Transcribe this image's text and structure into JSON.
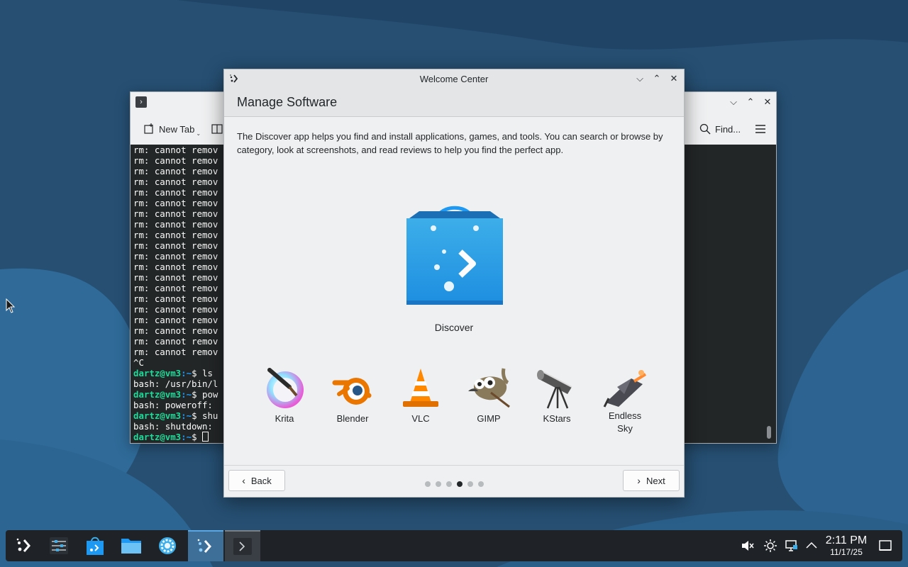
{
  "terminal_window": {
    "toolbar": {
      "new_tab_label": "New Tab",
      "find_label": "Find..."
    },
    "lines": [
      {
        "text": "rm: cannot remov"
      },
      {
        "text": "rm: cannot remov"
      },
      {
        "text": "rm: cannot remov"
      },
      {
        "text": "rm: cannot remov"
      },
      {
        "text": "rm: cannot remov"
      },
      {
        "text": "rm: cannot remov"
      },
      {
        "text": "rm: cannot remov"
      },
      {
        "text": "rm: cannot remov"
      },
      {
        "text": "rm: cannot remov"
      },
      {
        "text": "rm: cannot remov"
      },
      {
        "text": "rm: cannot remov"
      },
      {
        "text": "rm: cannot remov"
      },
      {
        "text": "rm: cannot remov"
      },
      {
        "text": "rm: cannot remov"
      },
      {
        "text": "rm: cannot remov"
      },
      {
        "text": "rm: cannot remov"
      },
      {
        "text": "rm: cannot remov"
      },
      {
        "text": "rm: cannot remov"
      },
      {
        "text": "rm: cannot remov"
      },
      {
        "text": "rm: cannot remov"
      },
      {
        "text": "^C"
      },
      {
        "user": "dartz@vm3",
        "path": ":~",
        "cmd": "$ ls"
      },
      {
        "text": "bash: /usr/bin/l"
      },
      {
        "user": "dartz@vm3",
        "path": ":~",
        "cmd": "$ pow"
      },
      {
        "text": "bash: poweroff:"
      },
      {
        "user": "dartz@vm3",
        "path": ":~",
        "cmd": "$ shu"
      },
      {
        "text": "bash: shutdown:"
      },
      {
        "user": "dartz@vm3",
        "path": ":~",
        "cmd": "$ ",
        "cursor": true
      }
    ]
  },
  "welcome_window": {
    "title": "Welcome Center",
    "page_title": "Manage Software",
    "description": "The Discover app helps you find and install applications, games, and tools. You can search or browse by category, look at screenshots, and read reviews to help you find the perfect app.",
    "hero_app": "Discover",
    "apps": [
      {
        "name": "Krita",
        "icon": "krita-icon"
      },
      {
        "name": "Blender",
        "icon": "blender-icon"
      },
      {
        "name": "VLC",
        "icon": "vlc-icon"
      },
      {
        "name": "GIMP",
        "icon": "gimp-icon"
      },
      {
        "name": "KStars",
        "icon": "kstars-icon"
      },
      {
        "name": "Endless Sky",
        "icon": "endless-sky-icon"
      }
    ],
    "back_label": "Back",
    "next_label": "Next",
    "pages_total": 6,
    "current_page": 4
  },
  "taskbar": {
    "time": "2:11 PM",
    "date": "11/17/25",
    "accent_color": "#3d6f98"
  }
}
